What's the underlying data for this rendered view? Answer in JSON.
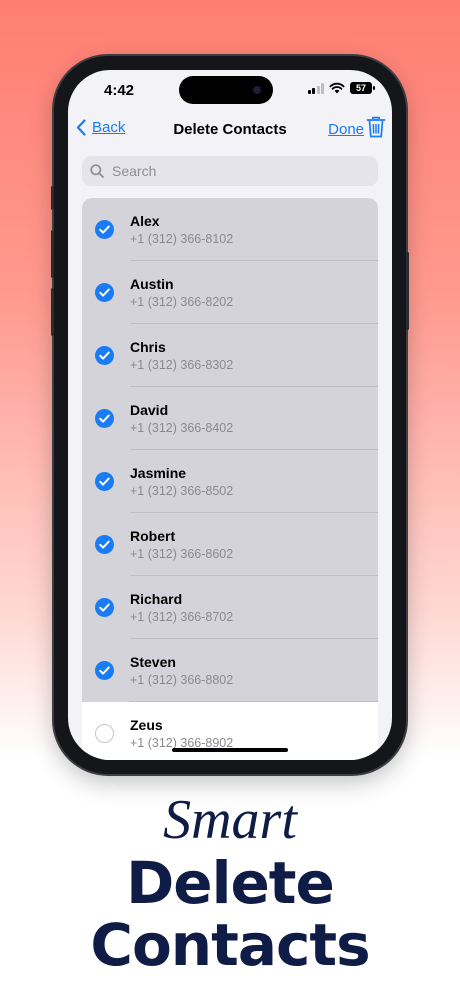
{
  "status": {
    "time": "4:42",
    "battery": "57"
  },
  "nav": {
    "back_label": "Back",
    "title": "Delete Contacts",
    "done_label": "Done"
  },
  "search": {
    "placeholder": "Search"
  },
  "contacts": [
    {
      "name": "Alex",
      "phone": "+1 (312) 366-8102",
      "selected": true
    },
    {
      "name": "Austin",
      "phone": "+1 (312) 366-8202",
      "selected": true
    },
    {
      "name": "Chris",
      "phone": "+1 (312) 366-8302",
      "selected": true
    },
    {
      "name": "David",
      "phone": "+1 (312) 366-8402",
      "selected": true
    },
    {
      "name": "Jasmine",
      "phone": "+1 (312) 366-8502",
      "selected": true
    },
    {
      "name": "Robert",
      "phone": "+1 (312) 366-8602",
      "selected": true
    },
    {
      "name": "Richard",
      "phone": "+1 (312) 366-8702",
      "selected": true
    },
    {
      "name": "Steven",
      "phone": "+1 (312) 366-8802",
      "selected": true
    },
    {
      "name": "Zeus",
      "phone": "+1 (312) 366-8902",
      "selected": false
    }
  ],
  "promo": {
    "line1": "Smart",
    "line2": "Delete",
    "line3": "Contacts"
  },
  "colors": {
    "accent": "#1a7cf5",
    "selected_row": "#d3d3d9",
    "headline": "#0f1c45"
  },
  "icons": [
    "back-chevron-icon",
    "trash-icon",
    "search-icon",
    "check-icon",
    "signal-icon",
    "wifi-icon",
    "battery-icon"
  ]
}
